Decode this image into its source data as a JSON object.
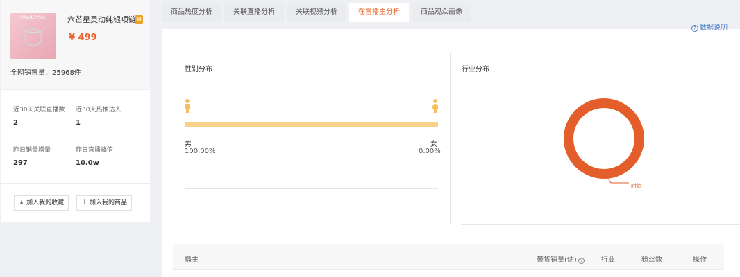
{
  "product": {
    "image_text": "SWAROVSKI",
    "title": "六芒星灵动纯银项链",
    "price": "¥ 499",
    "total_sales": "全网销售量：25968件"
  },
  "stats": [
    {
      "label": "近30天关联直播数",
      "value": "2"
    },
    {
      "label": "近30天热推达人",
      "value": "1"
    },
    {
      "label": "昨日销量增量",
      "value": "297"
    },
    {
      "label": "昨日直播峰值",
      "value": "10.0w"
    }
  ],
  "actions": {
    "favorite": "加入我的收藏",
    "add_goods": "加入我的商品"
  },
  "tabs": [
    {
      "label": "商品热度分析"
    },
    {
      "label": "关联直播分析"
    },
    {
      "label": "关联视频分析"
    },
    {
      "label": "在售播主分析"
    },
    {
      "label": "商品观众画像"
    }
  ],
  "help": {
    "label": "数据说明"
  },
  "gender": {
    "title": "性别分布",
    "male_label": "男",
    "female_label": "女",
    "male_pct": "100.00%",
    "female_pct": "0.00%",
    "male_share": 1.0
  },
  "industry": {
    "title": "行业分布",
    "segments": [
      {
        "name": "时尚",
        "share": 1.0,
        "color": "#e35e2a"
      }
    ]
  },
  "table": {
    "columns": [
      "播主",
      "带货销量(估)",
      "行业",
      "粉丝数",
      "操作"
    ]
  },
  "colors": {
    "accent": "#e8632a",
    "bar": "#f9d089",
    "donut": "#e35e2a",
    "link": "#4a7cc9"
  }
}
